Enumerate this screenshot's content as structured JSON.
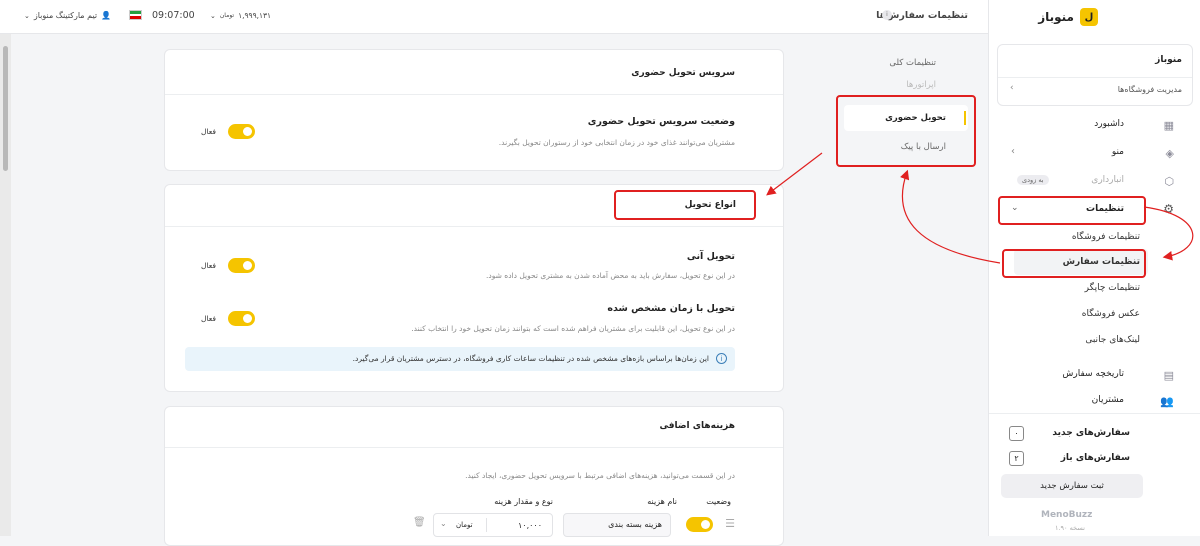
{
  "topbar": {
    "page_title": "تنظیمات سفارش‌ها",
    "price": "۱,۹۹۹,۱۳۱",
    "price_unit": "تومان",
    "time": "09:07:00",
    "team": "تیم مارکتینگ منوباز"
  },
  "sidebar": {
    "brand": "منوباز",
    "store_name": "منوباز",
    "store_manage": "مدیریت فروشگاه‌ها",
    "dashboard": "داشبورد",
    "menu": "منو",
    "inventory": "انبارداری",
    "inventory_badge": "به زودی",
    "settings": "تنظیمات",
    "sub_items": [
      "تنظیمات فروشگاه",
      "تنظیمات سفارش",
      "تنظیمات چاپگر",
      "عکس فروشگاه",
      "لینک‌های جانبی"
    ],
    "order_history": "تاریخچه سفارش",
    "customers": "مشتریان",
    "new_orders": "سفارش‌های جدید",
    "new_orders_count": "۰",
    "open_orders": "سفارش‌های باز",
    "open_orders_count": "۲",
    "new_order_button": "ثبت سفارش جدید",
    "footer_brand": "MenoBuzz",
    "footer_version": "نسخه ۱.۹۰"
  },
  "settings_nav": {
    "general": "تنظیمات کلی",
    "hidden_item": "اپراتورها",
    "in_person": "تحویل حضوری",
    "courier": "ارسال با پیک"
  },
  "card1": {
    "header": "سرویس تحویل حضوری",
    "title": "وضعیت سرویس تحویل حضوری",
    "desc": "مشتریان می‌توانند غذای خود در زمان انتخابی خود از رستوران تحویل بگیرند.",
    "toggle_label": "فعال"
  },
  "card2": {
    "header": "انواع تحویل",
    "instant_title": "تحویل آنی",
    "instant_desc": "در این نوع تحویل، سفارش باید به محض آماده شدن به مشتری تحویل داده شود.",
    "instant_toggle": "فعال",
    "scheduled_title": "تحویل با زمان مشخص شده",
    "scheduled_desc": "در این نوع تحویل، این قابلیت برای مشتریان فراهم شده است که بتوانند زمان تحویل خود را انتخاب کنند.",
    "scheduled_toggle": "فعال",
    "info": "این زمان‌ها براساس بازه‌های مشخص شده در تنظیمات ساعات کاری فروشگاه، در دسترس مشتریان قرار می‌گیرد."
  },
  "card3": {
    "header": "هزینه‌های اضافی",
    "desc": "در این قسمت می‌توانید، هزینه‌های اضافی مرتبط با سرویس تحویل حضوری، ایجاد کنید.",
    "col_status": "وضعیت",
    "col_name": "نام هزینه",
    "col_type": "نوع و مقدار هزینه",
    "row_name": "هزینه بسته بندی",
    "row_amount": "۱۰,۰۰۰",
    "row_unit": "تومان"
  },
  "colors": {
    "accent": "#f5c400",
    "annotation": "#e02020"
  }
}
